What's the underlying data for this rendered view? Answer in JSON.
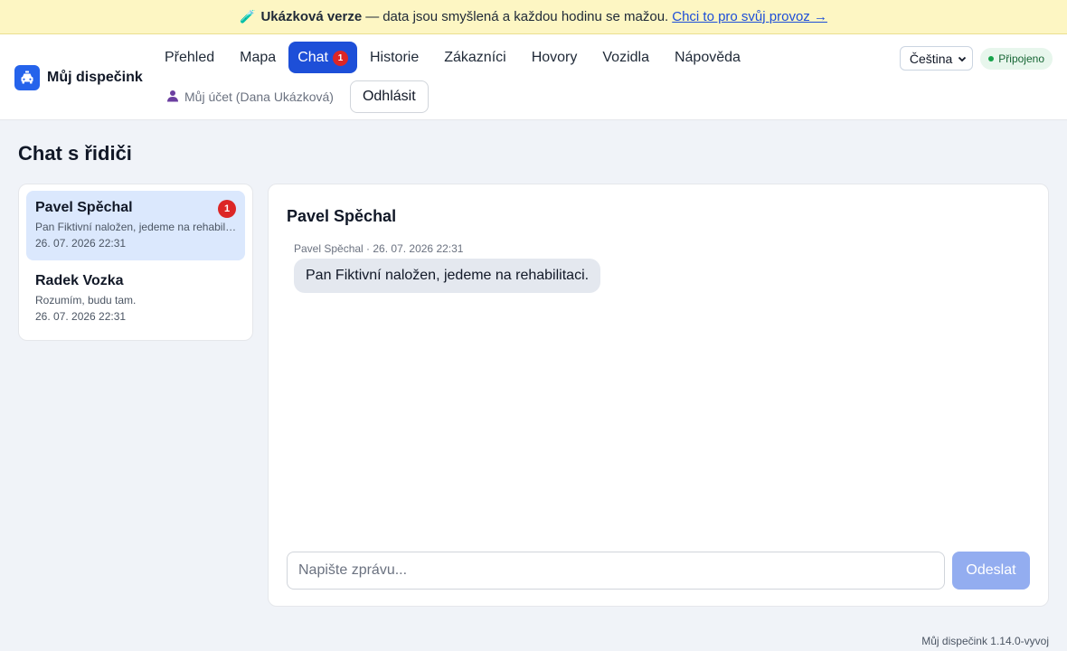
{
  "banner": {
    "title": "Ukázková verze",
    "separator": "—",
    "text": "data jsou smyšlená a každou hodinu se mažou.",
    "link": "Chci to pro svůj provoz →"
  },
  "brand": {
    "name": "Můj dispečink"
  },
  "nav": {
    "items": [
      {
        "label": "Přehled"
      },
      {
        "label": "Mapa"
      },
      {
        "label": "Chat",
        "badge": "1",
        "active": true
      },
      {
        "label": "Historie"
      },
      {
        "label": "Zákazníci"
      },
      {
        "label": "Hovory"
      },
      {
        "label": "Vozidla"
      },
      {
        "label": "Nápověda"
      }
    ],
    "account_label": "Můj účet (Dana Ukázková)",
    "logout_label": "Odhlásit"
  },
  "language": {
    "selected": "Čeština"
  },
  "connection": {
    "status": "Připojeno",
    "color": "#16a34a"
  },
  "page": {
    "title": "Chat s řidiči"
  },
  "conversations": [
    {
      "name": "Pavel Spěchal",
      "preview": "Pan Fiktivní naložen, jedeme na rehabilitaci.",
      "time": "26. 07. 2026 22:31",
      "unread": "1",
      "selected": true
    },
    {
      "name": "Radek Vozka",
      "preview": "Rozumím, budu tam.",
      "time": "26. 07. 2026 22:31"
    }
  ],
  "chat": {
    "title": "Pavel Spěchal",
    "messages": [
      {
        "meta": "Pavel Spěchal · 26. 07. 2026 22:31",
        "text": "Pan Fiktivní naložen, jedeme na rehabilitaci."
      }
    ],
    "input_placeholder": "Napište zprávu...",
    "send_label": "Odeslat"
  },
  "footer": {
    "version": "Můj dispečink 1.14.0-vyvoj"
  },
  "colors": {
    "accent": "#1d4fd8",
    "badge": "#dc2626",
    "banner": "#fdf6c3"
  }
}
